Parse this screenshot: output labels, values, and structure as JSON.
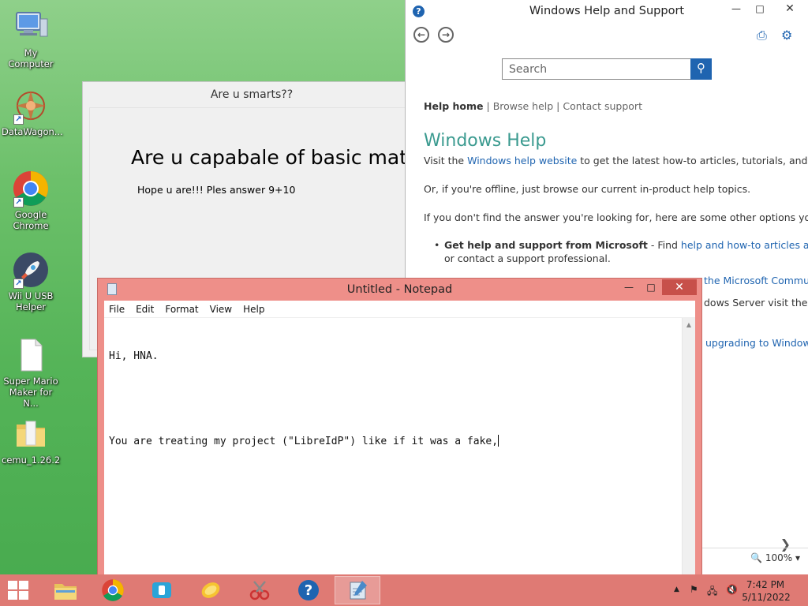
{
  "desktop": {
    "icons": [
      {
        "label": "My Computer",
        "icon": "computer-icon"
      },
      {
        "label": "DataWagon...",
        "icon": "datawagon-icon"
      },
      {
        "label": "Google Chrome",
        "icon": "chrome-icon"
      },
      {
        "label": "Wii U USB Helper",
        "icon": "rocket-icon"
      },
      {
        "label": "Super Mario Maker for N...",
        "icon": "file-icon"
      },
      {
        "label": "cemu_1.26.2",
        "icon": "folder-icon"
      }
    ]
  },
  "quiz_window": {
    "title": "Are u smarts??",
    "heading": "Are u capabale of basic mat",
    "subtext": "Hope u are!!! Ples answer 9+10"
  },
  "help_window": {
    "title": "Windows Help and Support",
    "search_placeholder": "Search",
    "links": {
      "home": "Help home",
      "sep1": " | ",
      "browse": "Browse help",
      "sep2": " | ",
      "contact": "Contact support"
    },
    "heading": "Windows Help",
    "p1_pre": "Visit the ",
    "p1_link": "Windows help website",
    "p1_post": " to get the latest how-to articles, tutorials, and suppo",
    "p2": "Or, if you're offline, just browse our current in-product help topics.",
    "p3": "If you don't find the answer you're looking for, here are some other options you can",
    "b1_strong": "Get help and support from Microsoft",
    "b1_mid": " - Find ",
    "b1_link": "help and how-to articles and vi",
    "b1_line2": "or contact a support professional.",
    "b2_link": "the Microsoft Commu",
    "b3_text": "dows Server visit the",
    "b4_link": "upgrading to Window",
    "zoom": "100%"
  },
  "notepad": {
    "title": "Untitled - Notepad",
    "menu": [
      "File",
      "Edit",
      "Format",
      "View",
      "Help"
    ],
    "lines": [
      "Hi, HNA.",
      "",
      "You are treating my project (\"LibreIdP\") like if it was a fake,"
    ]
  },
  "taskbar": {
    "time": "7:42 PM",
    "date": "5/11/2022"
  },
  "colors": {
    "accent": "#df7a74",
    "help_blue": "#1f64b0",
    "help_teal": "#3a9a8f"
  }
}
